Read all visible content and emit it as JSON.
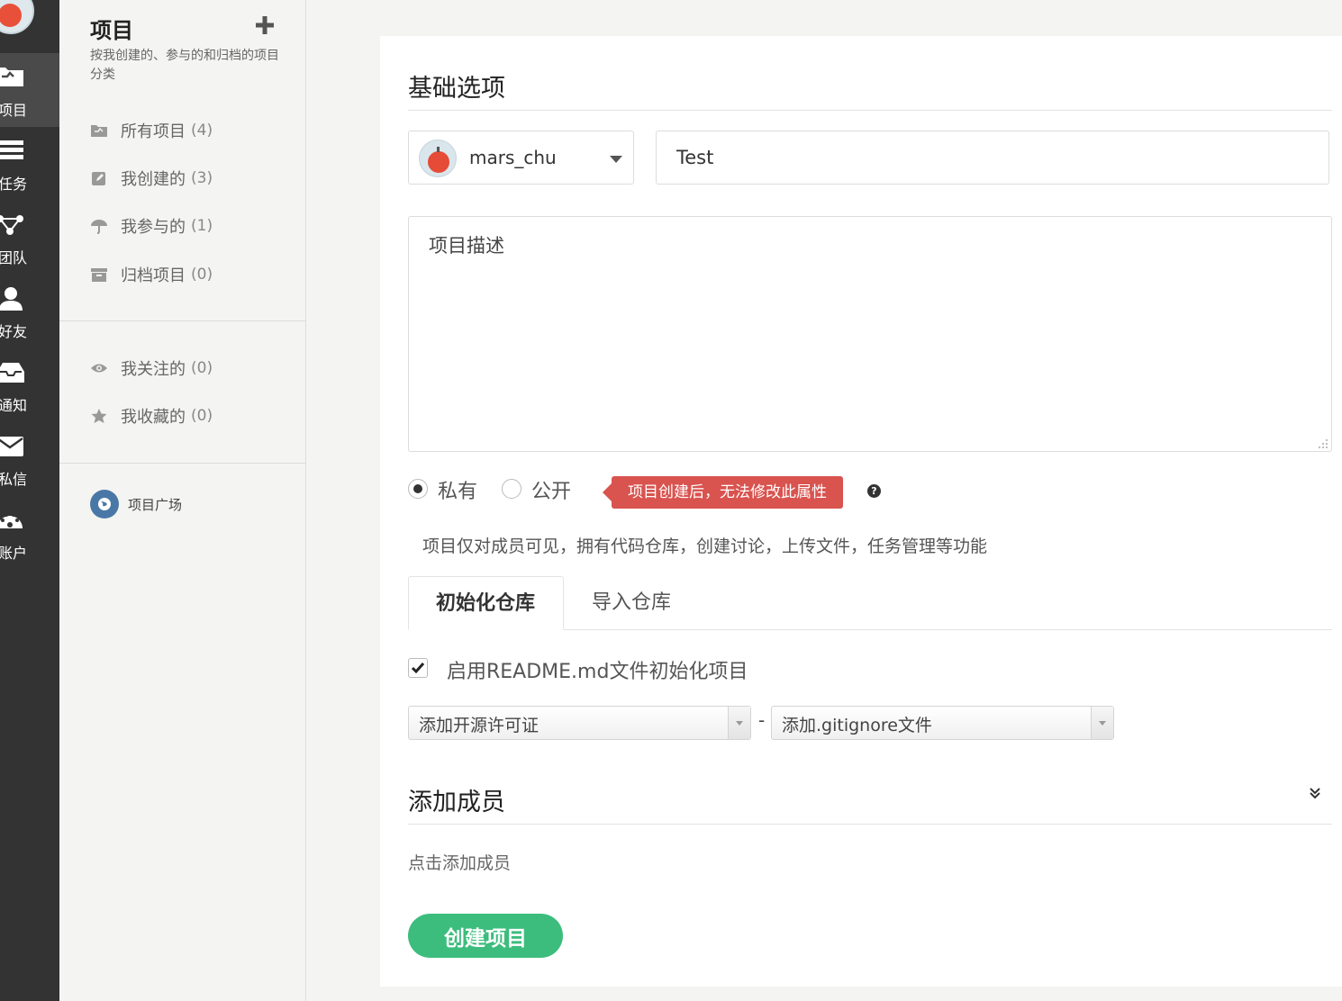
{
  "rail": {
    "items": [
      {
        "label": "项目",
        "icon": "folder-icon"
      },
      {
        "label": "任务",
        "icon": "tasks-icon"
      },
      {
        "label": "团队",
        "icon": "team-icon"
      },
      {
        "label": "好友",
        "icon": "user-icon"
      },
      {
        "label": "通知",
        "icon": "inbox-icon"
      },
      {
        "label": "私信",
        "icon": "envelope-icon"
      },
      {
        "label": "账户",
        "icon": "dashboard-icon"
      }
    ]
  },
  "sidebar": {
    "title": "项目",
    "description": "按我创建的、参与的和归档的项目分类",
    "links": [
      {
        "label": "所有项目",
        "count": "(4)",
        "icon": "folder-icon"
      },
      {
        "label": "我创建的",
        "count": "(3)",
        "icon": "edit-icon"
      },
      {
        "label": "我参与的",
        "count": "(1)",
        "icon": "umbrella-icon"
      },
      {
        "label": "归档项目",
        "count": "(0)",
        "icon": "archive-icon"
      },
      {
        "label": "我关注的",
        "count": "(0)",
        "icon": "eye-icon"
      },
      {
        "label": "我收藏的",
        "count": "(0)",
        "icon": "star-icon"
      }
    ],
    "plaza": "项目广场"
  },
  "form": {
    "basic_title": "基础选项",
    "owner": "mars_chu",
    "project_name": "Test",
    "description_placeholder": "项目描述",
    "visibility": {
      "private_label": "私有",
      "public_label": "公开",
      "selected": "private",
      "warning": "项目创建后，无法修改此属性",
      "description": "项目仅对成员可见，拥有代码仓库，创建讨论，上传文件，任务管理等功能"
    },
    "tabs": [
      "初始化仓库",
      "导入仓库"
    ],
    "readme_label": "启用README.md文件初始化项目",
    "readme_checked": true,
    "license_select": "添加开源许可证",
    "separator": "-",
    "gitignore_select": "添加.gitignore文件",
    "members_title": "添加成员",
    "members_hint": "点击添加成员",
    "create_button": "创建项目"
  },
  "colors": {
    "rail_bg": "#333333",
    "primary_green": "#3dbd7d",
    "warning_red": "#d9534f"
  }
}
